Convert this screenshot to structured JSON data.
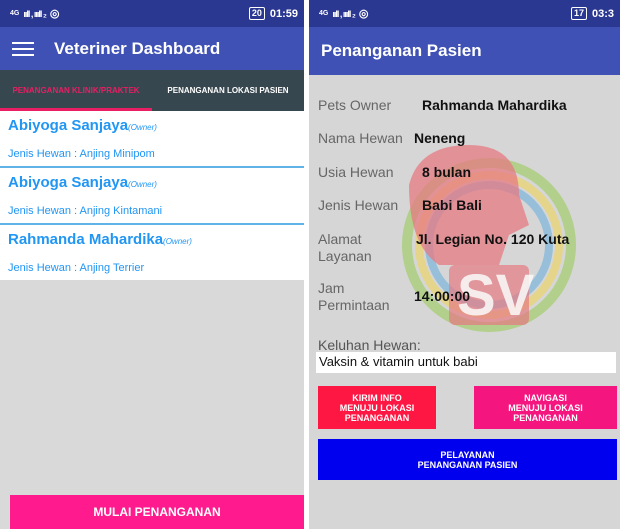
{
  "left": {
    "status": {
      "network": "4G",
      "signal": "ııll , ıııll ₂",
      "battery": "20",
      "time": "01:59"
    },
    "appbar": {
      "title": "Veteriner Dashboard"
    },
    "tabs": [
      {
        "label": "PENANGANAN KLINIK/PRAKTEK",
        "active": true
      },
      {
        "label": "PENANGANAN LOKASI PASIEN",
        "active": false
      }
    ],
    "list": [
      {
        "owner": "Abiyoga Sanjaya",
        "tag": "(Owner)",
        "animal": "Jenis Hewan : Anjing Minipom"
      },
      {
        "owner": "Abiyoga Sanjaya",
        "tag": "(Owner)",
        "animal": "Jenis Hewan : Anjing Kintamani"
      },
      {
        "owner": "Rahmanda Mahardika",
        "tag": "(Owner)",
        "animal": "Jenis Hewan : Anjing Terrier"
      }
    ],
    "start_button": "MULAI PENANGANAN"
  },
  "right": {
    "status": {
      "network": "4G",
      "signal": "ııll , ıııll ₂",
      "battery": "17",
      "time": "03:3"
    },
    "appbar": {
      "title": "Penanganan Pasien"
    },
    "fields": {
      "owner": {
        "label": "Pets Owner",
        "value": "Rahmanda Mahardika"
      },
      "nama": {
        "label": "Nama Hewan",
        "value": "Neneng"
      },
      "usia": {
        "label": "Usia Hewan",
        "value": "8 bulan"
      },
      "jenis": {
        "label": "Jenis Hewan",
        "value": "Babi Bali"
      },
      "alamat": {
        "label": "Alamat\nLayanan",
        "value": "Jl. Legian No. 120 Kuta"
      },
      "jam": {
        "label": "Jam\nPermintaan",
        "value": "14:00:00"
      }
    },
    "keluhan": {
      "label": "Keluhan Hewan:",
      "value": "Vaksin & vitamin untuk babi"
    },
    "buttons": {
      "kirim": "KIRIM INFO\nMENUJU LOKASI\nPENANGANAN",
      "navigasi": "NAVIGASI\nMENUJU LOKASI\nPENANGANAN",
      "pelayanan": "PELAYANAN\nPENANGANAN PASIEN"
    },
    "logo_text": "SV"
  },
  "colors": {
    "primary": "#3f51b5",
    "accent": "#e91e63",
    "list_text": "#2196f3",
    "start_button": "#ff1b8d",
    "red_button": "#ff1744",
    "pink_button": "#f4157f",
    "blue_button": "#0000ee"
  }
}
